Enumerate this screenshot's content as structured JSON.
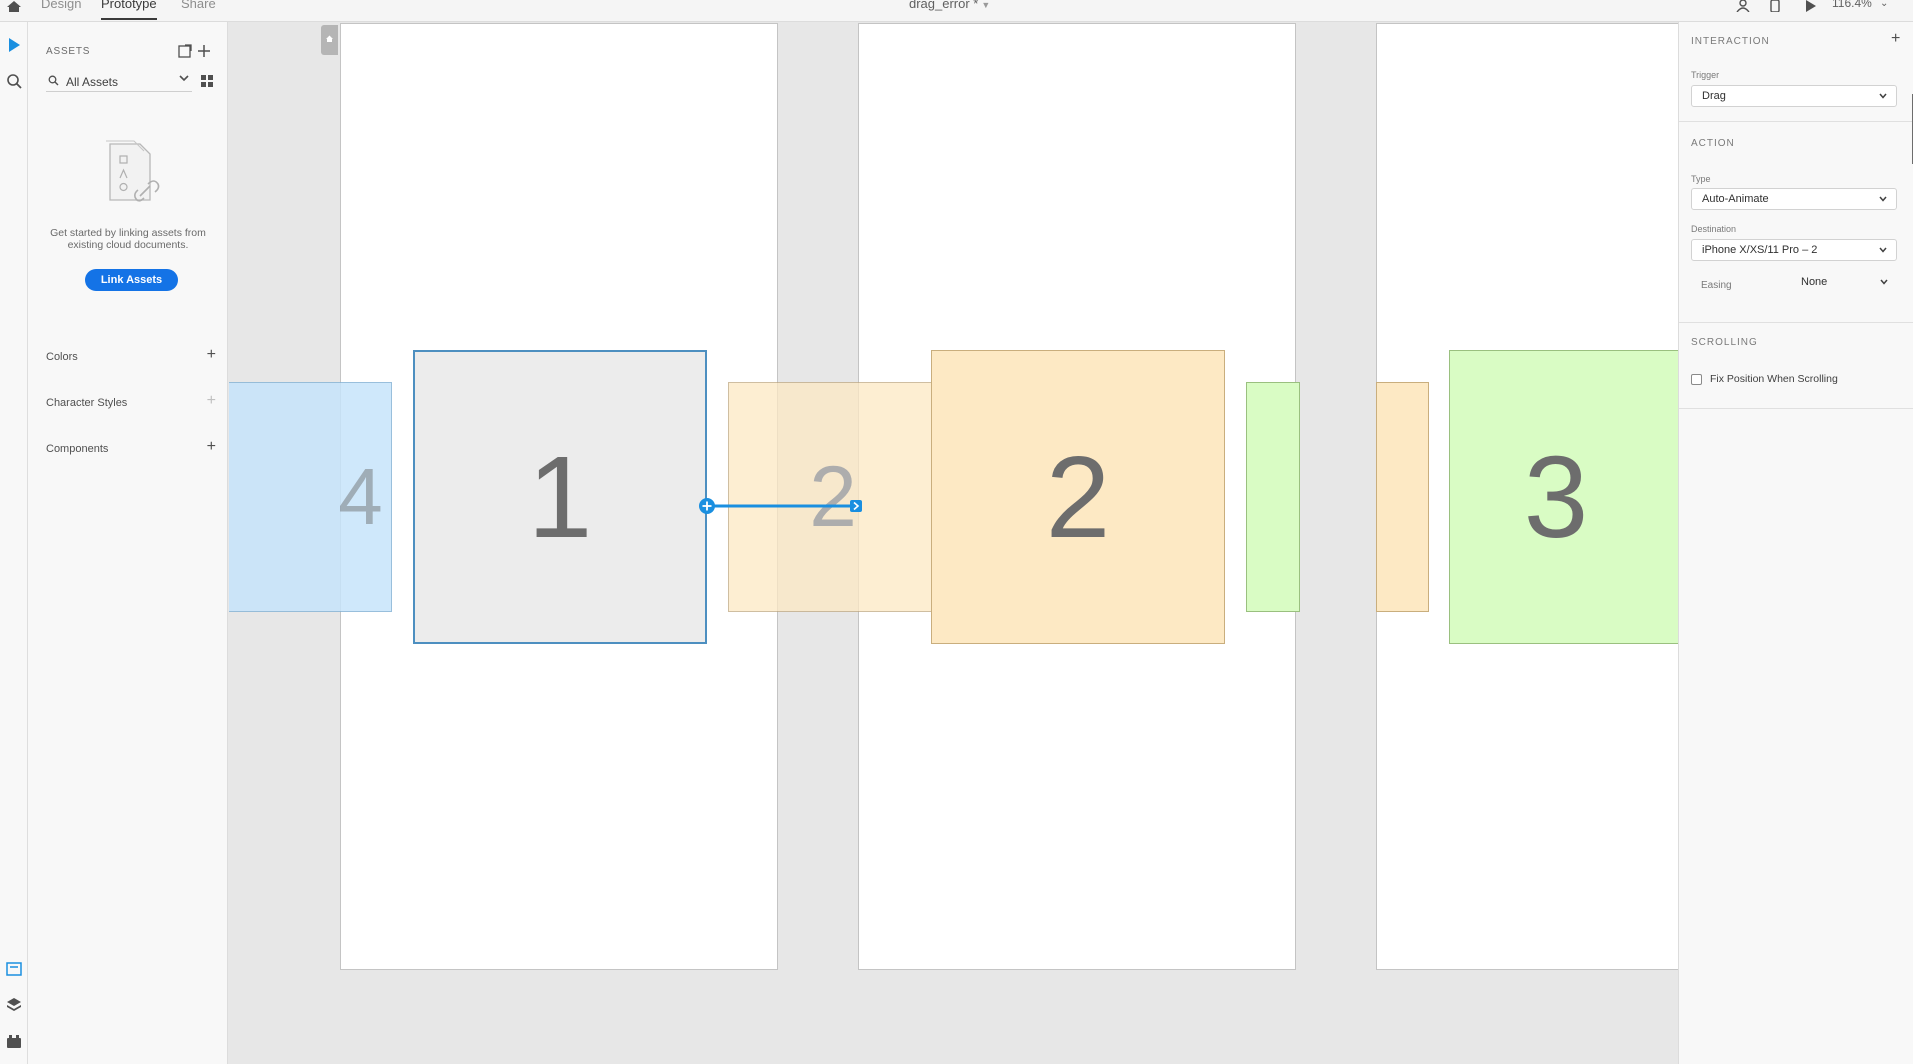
{
  "topbar": {
    "tabs": [
      {
        "label": "Design",
        "active": false
      },
      {
        "label": "Prototype",
        "active": true
      },
      {
        "label": "Share",
        "active": false
      }
    ],
    "document_title": "drag_error *",
    "zoom": "116.4%",
    "icons": [
      "home-icon",
      "user-icon",
      "device-preview-icon",
      "play-icon"
    ]
  },
  "rail": {
    "icons": [
      "select-arrow-icon",
      "zoom-search-icon",
      "artboard-icon",
      "layers-icon",
      "plugins-icon"
    ]
  },
  "assets": {
    "title": "ASSETS",
    "search_value": "All Assets",
    "empty_text": "Get started by linking assets from existing cloud documents.",
    "link_button": "Link Assets",
    "sections": [
      {
        "label": "Colors",
        "plus_enabled": true
      },
      {
        "label": "Character Styles",
        "plus_enabled": false
      },
      {
        "label": "Components",
        "plus_enabled": true
      }
    ]
  },
  "canvas": {
    "tiles": [
      {
        "label": "4",
        "color": "#c7e4fb"
      },
      {
        "label": "1",
        "color": "#ececec"
      },
      {
        "label": "2",
        "color": "#fde9c4"
      },
      {
        "label": "2",
        "color": "#fde9c4"
      },
      {
        "label": "3",
        "color": "#d9fcc4"
      }
    ],
    "wire_color": "#1a8fe0"
  },
  "inspector": {
    "interaction_heading": "INTERACTION",
    "trigger_label": "Trigger",
    "trigger_value": "Drag",
    "action_heading": "ACTION",
    "type_label": "Type",
    "type_value": "Auto-Animate",
    "destination_label": "Destination",
    "destination_value": "iPhone X/XS/11 Pro – 2",
    "easing_label": "Easing",
    "easing_value": "None",
    "scrolling_heading": "SCROLLING",
    "fix_position_label": "Fix Position When Scrolling",
    "fix_position_checked": false
  }
}
